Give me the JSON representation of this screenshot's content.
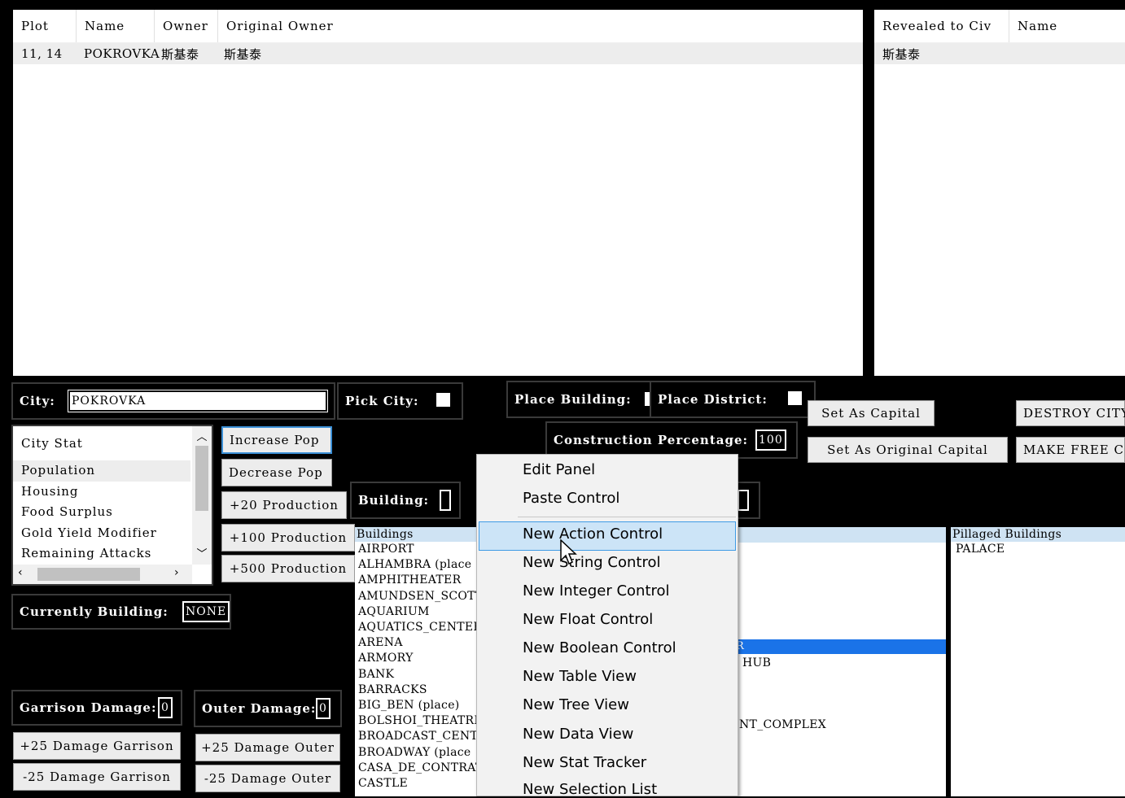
{
  "plot_table": {
    "headers": [
      "Plot",
      "Name",
      "Owner",
      "Original Owner"
    ],
    "row": [
      "11, 14",
      "POKROVKA",
      "斯基泰",
      "斯基泰"
    ]
  },
  "reveal_table": {
    "headers": [
      "Revealed to Civ",
      "Name"
    ],
    "row": [
      "斯基泰"
    ]
  },
  "city": {
    "label": "City:",
    "value": "POKROVKA"
  },
  "pick_city": {
    "label": "Pick City:"
  },
  "place_building": {
    "label": "Place Building:"
  },
  "place_district": {
    "label": "Place District:"
  },
  "construction": {
    "label": "Construction Percentage:",
    "value": "100"
  },
  "capital_buttons": {
    "set_capital": "Set As Capital",
    "set_original_capital": "Set As Original Capital"
  },
  "city_action_buttons": {
    "destroy": "DESTROY CITY",
    "free": "MAKE FREE CIT"
  },
  "city_stat": {
    "header": "City Stat",
    "items": [
      "Population",
      "Housing",
      "Food Surplus",
      "Gold Yield Modifier",
      "Remaining Attacks"
    ]
  },
  "pop_buttons": {
    "increase": "Increase Pop",
    "decrease": "Decrease Pop",
    "prod20": "+20 Production",
    "prod100": "+100 Production",
    "prod500": "+500 Production"
  },
  "building": {
    "label": "Building:",
    "value": ""
  },
  "currently_building": {
    "label": "Currently Building:",
    "value": "NONE"
  },
  "buildings_list": {
    "header": "Buildings",
    "items": [
      "AIRPORT",
      "ALHAMBRA (place",
      "AMPHITHEATER",
      "AMUNDSEN_SCOTT_",
      "AQUARIUM",
      "AQUATICS_CENTER",
      "ARENA",
      "ARMORY",
      "BANK",
      "BARRACKS",
      "BIG_BEN (place)",
      "BOLSHOI_THEATRE",
      "BROADCAST_CENTE",
      "BROADWAY (place",
      "CASA_DE_CONTRAT",
      "CASTLE"
    ]
  },
  "districts_fragments": {
    "hub": "HUB",
    "complex": "NT_COMPLEX",
    "sel": "R"
  },
  "pillaged": {
    "header": "Pillaged Buildings",
    "items": [
      "PALACE"
    ]
  },
  "garrison": {
    "label": "Garrison Damage:",
    "value": "0",
    "plus": "+25 Damage Garrison",
    "minus": "-25 Damage Garrison"
  },
  "outer": {
    "label": "Outer Damage:",
    "value": "0",
    "plus": "+25 Damage Outer",
    "minus": "-25 Damage Outer"
  },
  "context_menu": {
    "items": [
      "Edit Panel",
      "Paste Control",
      "New Action Control",
      "New String Control",
      "New Integer Control",
      "New Float Control",
      "New Boolean Control",
      "New Table View",
      "New Tree View",
      "New Data View",
      "New Stat Tracker",
      "New Selection List"
    ],
    "highlighted_index": 2
  },
  "colors": {
    "accent": "#3b8fd6",
    "selection": "#1a73e8",
    "list_header": "#cfe3f3",
    "menu_highlight": "#cce4f7"
  }
}
